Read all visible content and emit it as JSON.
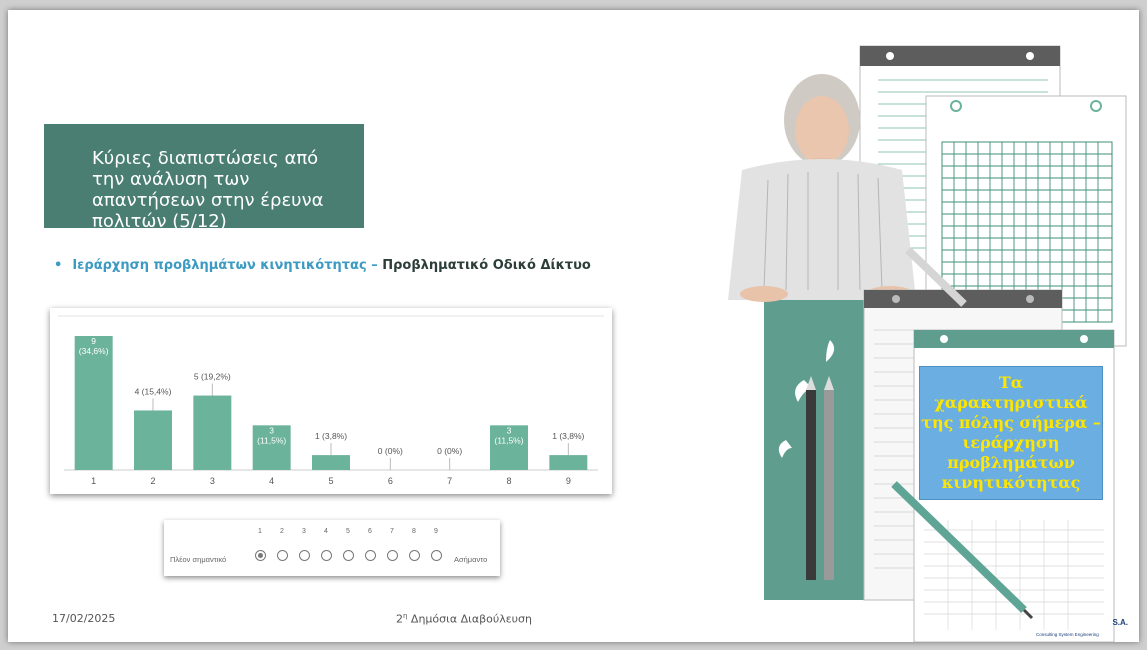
{
  "slide": {
    "title": "Κύριες διαπιστώσεις από την ανάλυση των απαντήσεων στην έρευνα πολιτών (5/12)",
    "bullet": {
      "marker": "•",
      "part1": "Ιεράρχηση προβλημάτων κινητικότητας",
      "dash": " – ",
      "part2": "Προβληματικό Οδικό Δίκτυο"
    },
    "callout": "Τα χαρακτηριστικά της πόλης σήμερα – ιεράρχηση προβλημάτων κινητικότητας",
    "footer": {
      "date": "17/02/2025",
      "event_prefix": "2",
      "event_sup": "η",
      "event_rest": " Δημόσια Διαβούλευση"
    },
    "logo_text": "S.A.",
    "logo_sub": "Consulting  System Engineering"
  },
  "scale": {
    "numbers": [
      "1",
      "2",
      "3",
      "4",
      "5",
      "6",
      "7",
      "8",
      "9"
    ],
    "left_label": "Πλέον σημαντικό",
    "right_label": "Ασήμαντο",
    "selected_index": 0
  },
  "colors": {
    "title_bg": "#4a7e73",
    "bar": "#6bb39b",
    "bullet_blue": "#3d9ac2",
    "callout_bg": "#6aaee2",
    "callout_text": "#ffe600"
  },
  "chart_data": {
    "type": "bar",
    "categories": [
      "1",
      "2",
      "3",
      "4",
      "5",
      "6",
      "7",
      "8",
      "9"
    ],
    "values": [
      9,
      4,
      5,
      3,
      1,
      0,
      0,
      3,
      1
    ],
    "labels": [
      "9 (34,6%)",
      "4 (15,4%)",
      "5 (19,2%)",
      "3 (11,5%)",
      "1 (3,8%)",
      "0 (0%)",
      "0 (0%)",
      "3 (11,5%)",
      "1 (3,8%)"
    ],
    "label_lines": [
      [
        "9",
        "(34,6%)"
      ],
      [
        "4 (15,4%)"
      ],
      [
        "5 (19,2%)"
      ],
      [
        "3",
        "(11,5%)"
      ],
      [
        "1 (3,8%)"
      ],
      [
        "0 (0%)"
      ],
      [
        "0 (0%)"
      ],
      [
        "3",
        "(11,5%)"
      ],
      [
        "1 (3,8%)"
      ]
    ],
    "label_inside": [
      true,
      false,
      false,
      true,
      false,
      false,
      false,
      true,
      false
    ],
    "ylim": [
      0,
      9
    ],
    "title": "",
    "xlabel": "",
    "ylabel": ""
  }
}
